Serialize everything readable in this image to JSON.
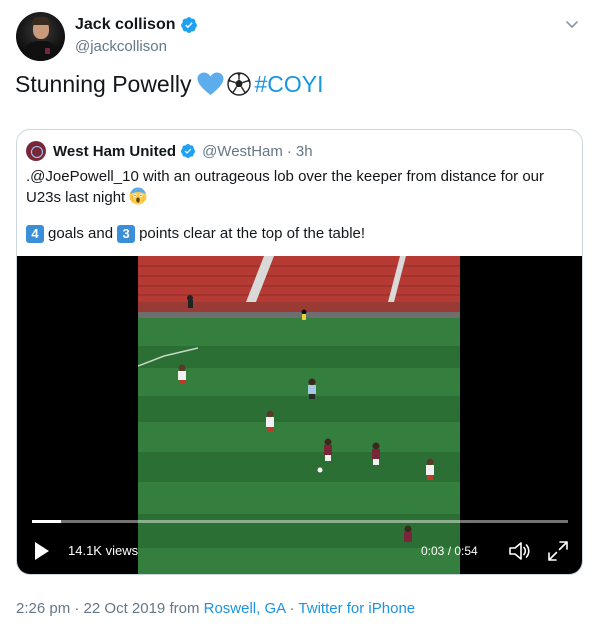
{
  "author": {
    "display_name": "Jack collison",
    "handle": "@jackcollison"
  },
  "tweet": {
    "text": "Stunning Powelly",
    "hashtag": "#COYI"
  },
  "quoted": {
    "display_name": "West Ham United",
    "handle": "@WestHam",
    "separator": "·",
    "time": "3h",
    "text_line1": ".@JoePowell_10 with an outrageous lob over the keeper from distance for our U23s last night",
    "num_goals": "4",
    "text_goals": "goals and",
    "num_points": "3",
    "text_points": "points clear at the top of the table!"
  },
  "video": {
    "views": "14.1K views",
    "timecode": "0:03 / 0:54",
    "progress": 0.055
  },
  "footer": {
    "time": "2:26 pm",
    "separator1": "·",
    "date": "22 Oct 2019",
    "from_label": "from",
    "location": "Roswell, GA",
    "separator2": "·",
    "client": "Twitter for iPhone"
  },
  "colors": {
    "link": "#1b95e0",
    "verified": "#1da1f2",
    "secondary_text": "#657786",
    "border": "#ccd6dd",
    "pitch": "#2f7d3a",
    "stand_seats": "#b53a33"
  },
  "icons": {
    "verified": "verified-badge-icon",
    "caret": "chevron-down-icon",
    "play": "play-icon",
    "volume": "volume-icon",
    "fullscreen": "expand-icon",
    "heart": "blue-heart-emoji",
    "ball": "soccer-ball-emoji",
    "face": "face-screaming-emoji"
  }
}
